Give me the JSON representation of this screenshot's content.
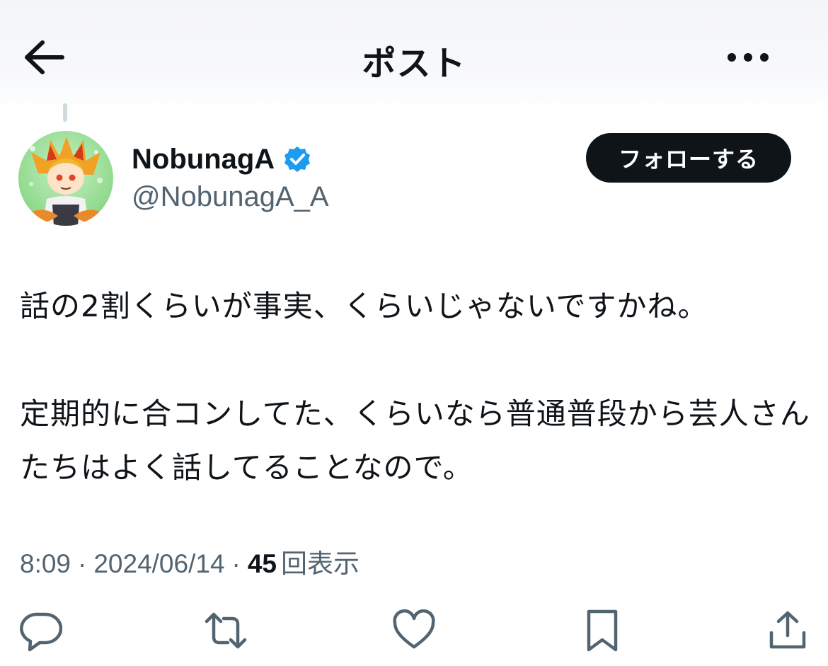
{
  "header": {
    "title": "ポスト",
    "back_icon": "arrow-left-icon",
    "more_icon": "more-horizontal-icon"
  },
  "author": {
    "name": "NobunagA",
    "handle": "@NobunagA_A",
    "verified": true,
    "verified_color": "#1d9bf0",
    "avatar": "avatar-illustration"
  },
  "follow_button": {
    "label": "フォローする"
  },
  "post": {
    "text": "話の2割くらいが事実、くらいじゃないですかね。\n\n定期的に合コンしてた、くらいなら普通普段から芸人さんたちはよく話してることなので。"
  },
  "meta": {
    "time": "8:09",
    "separator": "·",
    "date": "2024/06/14",
    "views_count": "45",
    "views_label": "回表示"
  },
  "actions": [
    {
      "name": "reply",
      "icon": "comment-icon"
    },
    {
      "name": "repost",
      "icon": "repost-icon"
    },
    {
      "name": "like",
      "icon": "heart-icon"
    },
    {
      "name": "bookmark",
      "icon": "bookmark-icon"
    },
    {
      "name": "share",
      "icon": "share-icon"
    }
  ],
  "colors": {
    "text": "#0f1419",
    "secondary": "#536471",
    "button_bg": "#0f1419",
    "button_text": "#ffffff"
  }
}
